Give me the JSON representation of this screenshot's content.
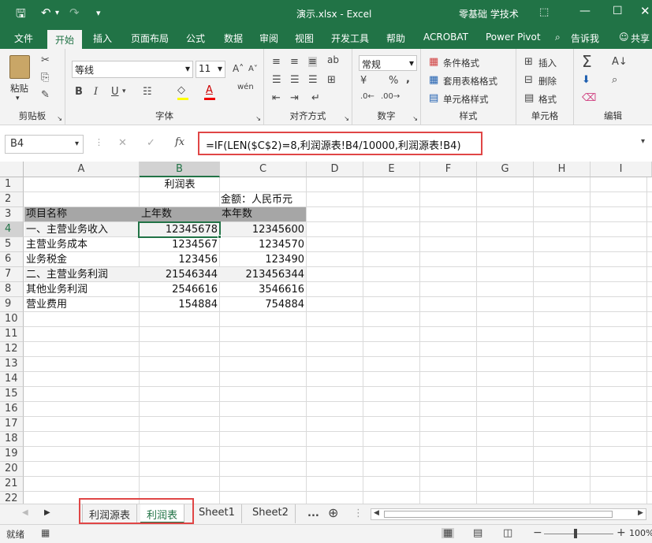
{
  "title_bar": {
    "file_title": "演示.xlsx - Excel",
    "account": "零基础 学技术"
  },
  "tabs": [
    "文件",
    "开始",
    "插入",
    "页面布局",
    "公式",
    "数据",
    "审阅",
    "视图",
    "开发工具",
    "帮助",
    "ACROBAT",
    "Power Pivot"
  ],
  "tell_me": "告诉我",
  "share": "共享",
  "ribbon": {
    "clipboard_label": "剪贴板",
    "paste_label": "粘贴",
    "font_label": "字体",
    "font_name": "等线",
    "font_size": "11",
    "bold": "B",
    "italic": "I",
    "underline": "U",
    "alignment_label": "对齐方式",
    "number_label": "数字",
    "number_format": "常规",
    "percent": "%",
    "comma": ",",
    "styles_label": "样式",
    "cond_format": "条件格式",
    "table_format": "套用表格格式",
    "cell_styles": "单元格样式",
    "cells_label": "单元格",
    "insert": "插入",
    "delete": "删除",
    "format": "格式",
    "editing_label": "编辑"
  },
  "formula_bar": {
    "name_box": "B4",
    "formula": "=IF(LEN($C$2)=8,利润源表!B4/10000,利润源表!B4)"
  },
  "columns": [
    "A",
    "B",
    "C",
    "D",
    "E",
    "F",
    "G",
    "H",
    "I"
  ],
  "rows": [
    "1",
    "2",
    "3",
    "4",
    "5",
    "6",
    "7",
    "8",
    "9",
    "10",
    "11",
    "12",
    "13",
    "14",
    "15",
    "16",
    "17",
    "18",
    "19",
    "20",
    "21",
    "22"
  ],
  "cells": {
    "b1": "利润表",
    "c2": "金额：人民币元",
    "a3": "项目名称",
    "b3": "上年数",
    "c3": "本年数",
    "data": [
      {
        "name": "一、主营业务收入",
        "prev": "12345678",
        "curr": "12345600"
      },
      {
        "name": "主营业务成本",
        "prev": "1234567",
        "curr": "1234570"
      },
      {
        "name": "业务税金",
        "prev": "123456",
        "curr": "123490"
      },
      {
        "name": "二、主营业务利润",
        "prev": "21546344",
        "curr": "213456344"
      },
      {
        "name": "其他业务利润",
        "prev": "2546616",
        "curr": "3546616"
      },
      {
        "name": "营业费用",
        "prev": "154884",
        "curr": "754884"
      }
    ]
  },
  "sheets": [
    "利润源表",
    "利润表",
    "Sheet1",
    "Sheet2"
  ],
  "sheet_more": "...",
  "status": {
    "ready": "就绪",
    "zoom": "100%"
  }
}
